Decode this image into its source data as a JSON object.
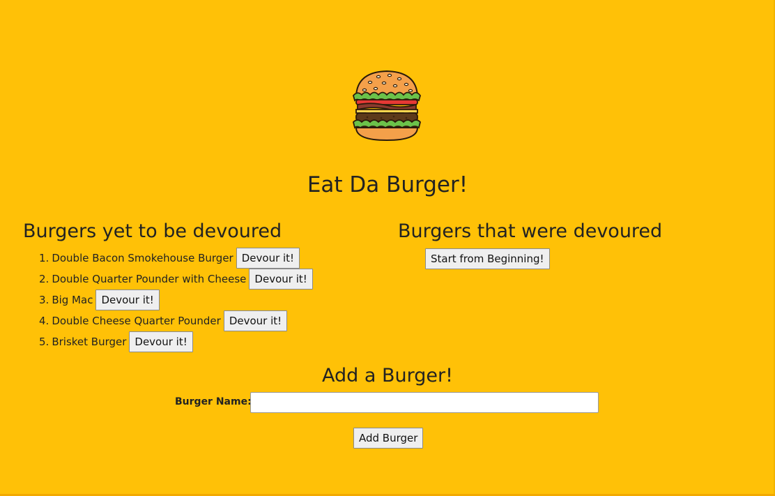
{
  "logo": {
    "icon": "burger-icon"
  },
  "title": "Eat Da Burger!",
  "undevoured": {
    "heading": "Burgers yet to be devoured",
    "items": [
      {
        "num": "1.",
        "name": "Double Bacon Smokehouse Burger",
        "button": "Devour it!"
      },
      {
        "num": "2.",
        "name": "Double Quarter Pounder with Cheese",
        "button": "Devour it!"
      },
      {
        "num": "3.",
        "name": "Big Mac",
        "button": "Devour it!"
      },
      {
        "num": "4.",
        "name": "Double Cheese Quarter Pounder",
        "button": "Devour it!"
      },
      {
        "num": "5.",
        "name": "Brisket Burger",
        "button": "Devour it!"
      }
    ]
  },
  "devoured": {
    "heading": "Burgers that were devoured",
    "reset_button": "Start from Beginning!"
  },
  "add_form": {
    "heading": "Add a Burger!",
    "label": "Burger Name:",
    "input_value": "",
    "submit_button": "Add Burger"
  },
  "colors": {
    "background": "#FFC107",
    "text": "#222222",
    "button_bg": "#EFEFEF"
  }
}
